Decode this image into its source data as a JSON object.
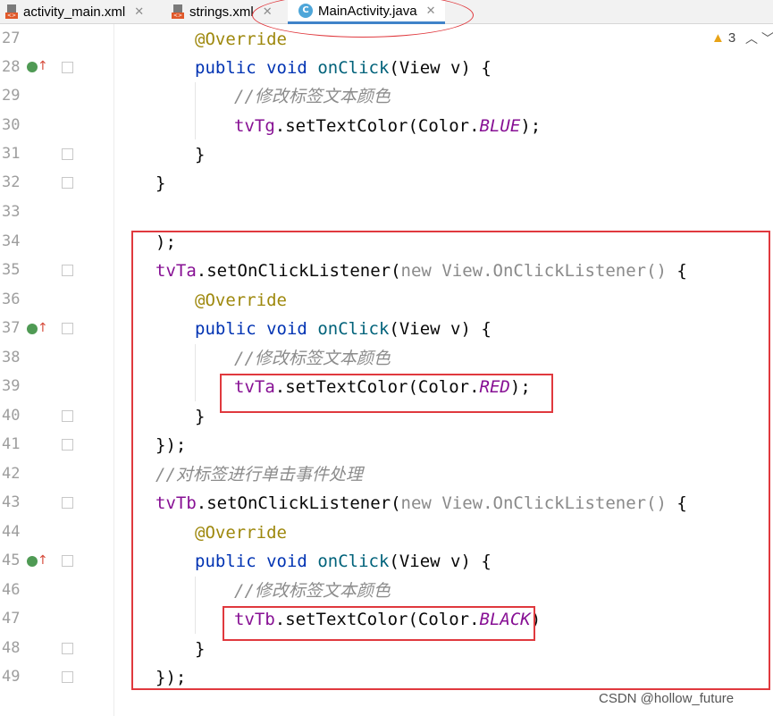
{
  "tabs": [
    {
      "label": "activity_main.xml",
      "icon": "xml-file-icon",
      "close": "✕"
    },
    {
      "label": "strings.xml",
      "icon": "xml-file-icon",
      "close": "✕"
    },
    {
      "label": "MainActivity.java",
      "icon": "java-class-icon",
      "close": "✕",
      "active": true
    }
  ],
  "class_icon_letter": "C",
  "xml_icon_tag": "<>",
  "inspections": {
    "count": "3"
  },
  "lines": [
    {
      "n": "27"
    },
    {
      "n": "28"
    },
    {
      "n": "29"
    },
    {
      "n": "30"
    },
    {
      "n": "31"
    },
    {
      "n": "32"
    },
    {
      "n": "33"
    },
    {
      "n": "34"
    },
    {
      "n": "35"
    },
    {
      "n": "36"
    },
    {
      "n": "37"
    },
    {
      "n": "38"
    },
    {
      "n": "39"
    },
    {
      "n": "40"
    },
    {
      "n": "41"
    },
    {
      "n": "42"
    },
    {
      "n": "43"
    },
    {
      "n": "44"
    },
    {
      "n": "45"
    },
    {
      "n": "46"
    },
    {
      "n": "47"
    },
    {
      "n": "48"
    },
    {
      "n": "49"
    }
  ],
  "code": {
    "override": "@Override",
    "public": "public",
    "void": "void",
    "onClick": "onClick",
    "params": "(View v) {",
    "comment_color": "//修改标签文本颜色",
    "comment_click": "//对标签进行单击事件处理",
    "tvTg": "tvTg",
    "tvTa": "tvTa",
    "tvTb": "tvTb",
    "setTextColor": ".setTextColor(Color.",
    "blue": "BLUE",
    "red": "RED",
    "black": "BLACK",
    "end_stmt": ");",
    "end_paren": ")",
    "close_brace": "}",
    "close_call": "});",
    "paren_semicolon": ");",
    "setListener": ".setOnClickListener(",
    "new": "new",
    "listener_type": " View.OnClickListener() ",
    "open_brace": "{"
  },
  "watermark": "CSDN @hollow_future",
  "colors": {
    "highlight_box": "#e0393e",
    "keyword": "#0033b3",
    "method": "#00627a",
    "annotation": "#9e880d",
    "comment": "#8c8c8c",
    "constant": "#871094"
  }
}
